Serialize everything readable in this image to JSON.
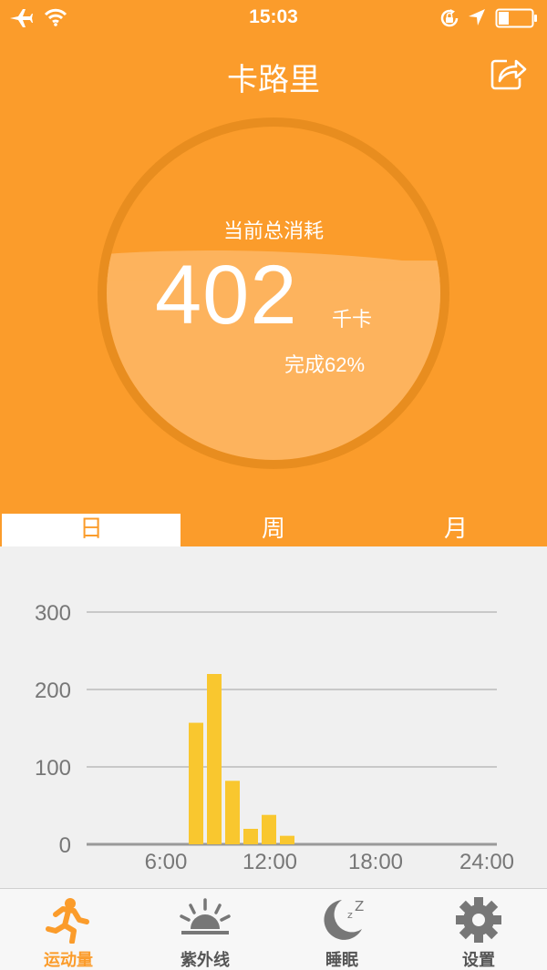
{
  "status_bar": {
    "time": "15:03"
  },
  "header": {
    "title": "卡路里"
  },
  "gauge": {
    "label": "当前总消耗",
    "value": "402",
    "unit": "千卡",
    "progress_text": "完成62%",
    "progress_percent": 62
  },
  "tabs": [
    {
      "label": "日",
      "active": true
    },
    {
      "label": "周",
      "active": false
    },
    {
      "label": "月",
      "active": false
    }
  ],
  "chart_data": {
    "type": "bar",
    "y_ticks": [
      "300",
      "200",
      "100",
      "0"
    ],
    "x_ticks": [
      "6:00",
      "12:00",
      "18:00",
      "24:00"
    ],
    "ylim": [
      0,
      300
    ],
    "xlim": [
      0,
      24
    ],
    "x": [
      8,
      9,
      10,
      11,
      12,
      13
    ],
    "values": [
      157,
      220,
      82,
      20,
      38,
      11
    ],
    "bar_color": "#f9c72f",
    "grid": true
  },
  "tab_bar": [
    {
      "label": "运动量",
      "icon": "running-icon",
      "active": true
    },
    {
      "label": "紫外线",
      "icon": "sun-icon",
      "active": false
    },
    {
      "label": "睡眠",
      "icon": "moon-icon",
      "active": false
    },
    {
      "label": "设置",
      "icon": "gear-icon",
      "active": false
    }
  ],
  "colors": {
    "accent": "#fb9c2b",
    "chart_bar": "#f9c72f",
    "background": "#f0f0f0"
  }
}
